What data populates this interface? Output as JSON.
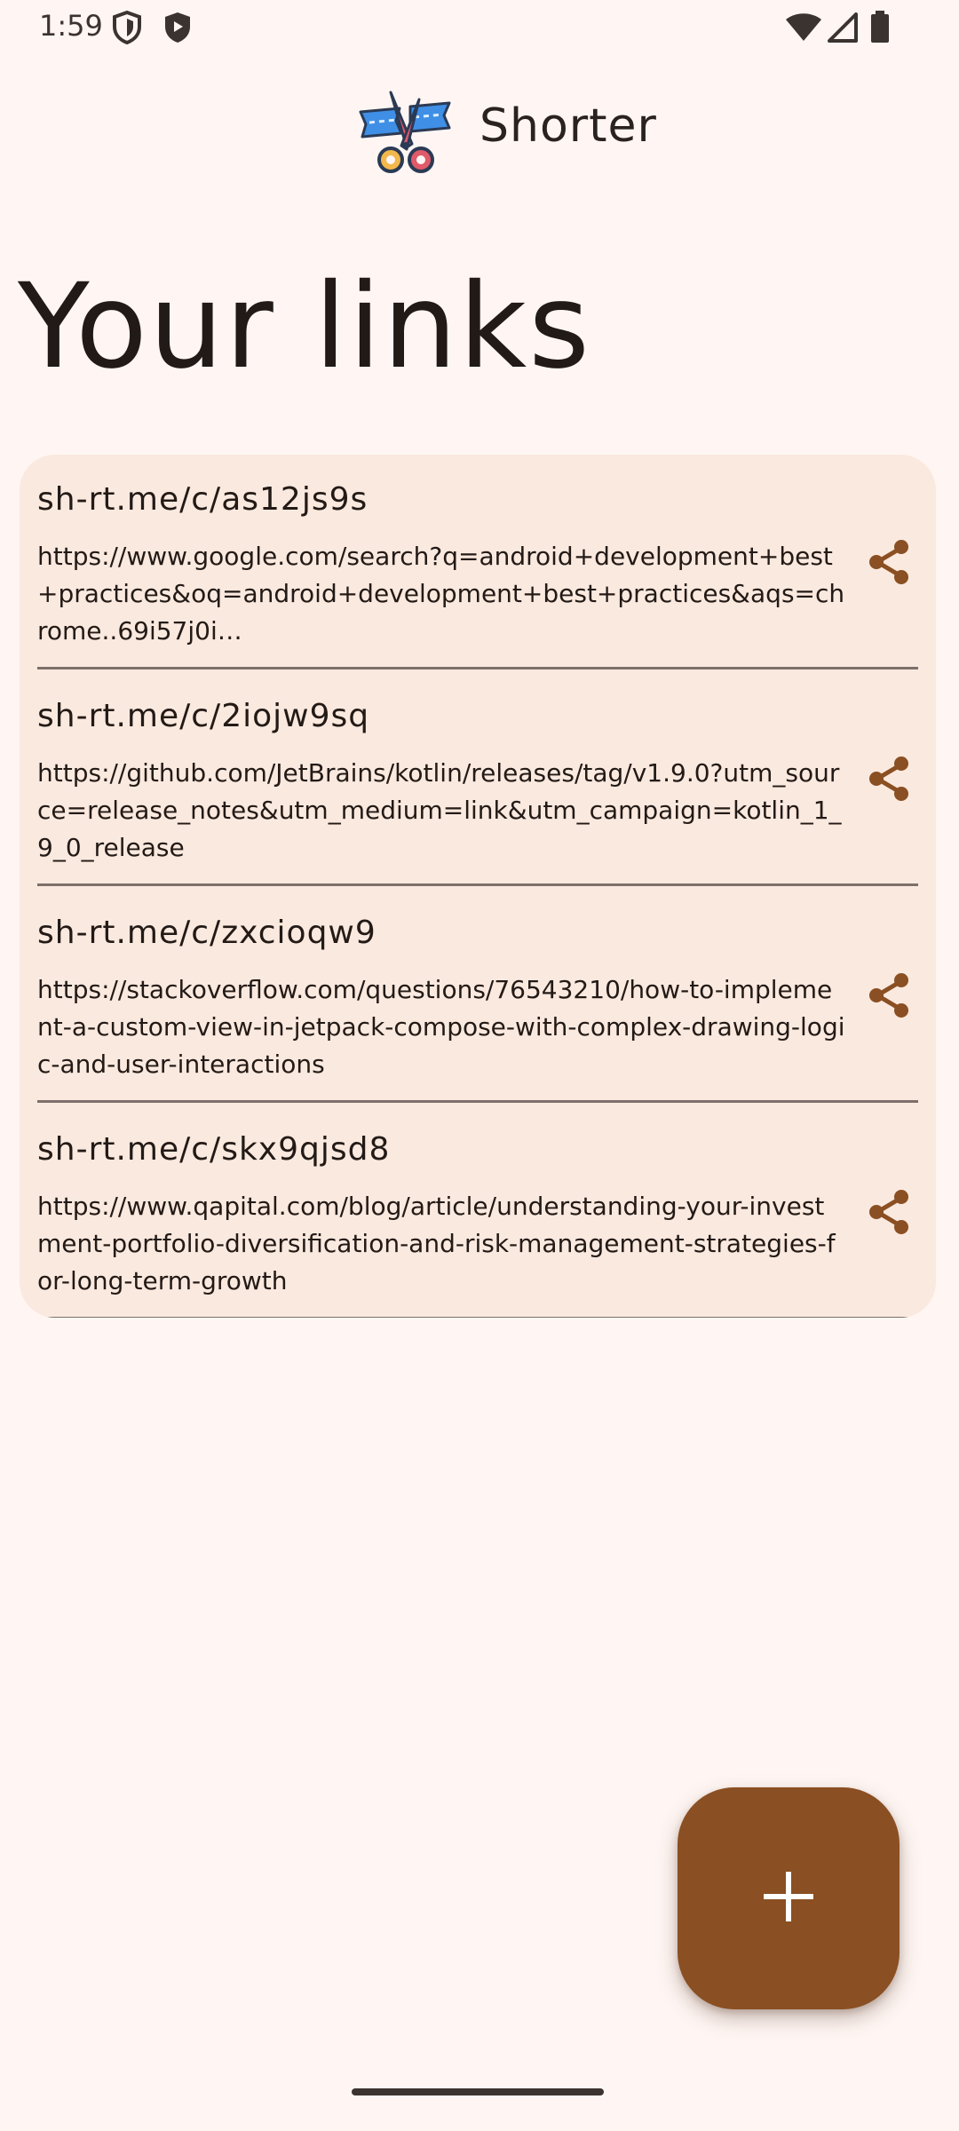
{
  "status_bar": {
    "time": "1:59",
    "icons_left": [
      "shield-outline-icon",
      "shield-filled-icon"
    ],
    "icons_right": [
      "wifi-icon",
      "cell-signal-icon",
      "battery-icon"
    ]
  },
  "app_bar": {
    "logo": "scissors-ribbon-logo-icon",
    "title": "Shorter"
  },
  "page": {
    "title": "Your links"
  },
  "links": [
    {
      "short": "sh-rt.me/c/as12js9s",
      "long": "https://www.google.com/search?q=android+development+best+practices&oq=android+development+best+practices&aqs=chrome..69i57j0i…",
      "action_icon": "share-icon"
    },
    {
      "short": "sh-rt.me/c/2iojw9sq",
      "long": "https://github.com/JetBrains/kotlin/releases/tag/v1.9.0?utm_source=release_notes&utm_medium=link&utm_campaign=kotlin_1_9_0_release",
      "action_icon": "share-icon"
    },
    {
      "short": "sh-rt.me/c/zxcioqw9",
      "long": "https://stackoverflow.com/questions/76543210/how-to-implement-a-custom-view-in-jetpack-compose-with-complex-drawing-logic-and-user-interactions",
      "action_icon": "share-icon"
    },
    {
      "short": "sh-rt.me/c/skx9qjsd8",
      "long": "https://www.qapital.com/blog/article/understanding-your-investment-portfolio-diversification-and-risk-management-strategies-for-long-term-growth",
      "action_icon": "share-icon"
    }
  ],
  "fab": {
    "icon": "plus-icon"
  },
  "colors": {
    "background": "#fff6f3",
    "card": "#fae9df",
    "accent": "#8a4f22",
    "divider": "#7d6f69",
    "text": "#231a16"
  }
}
